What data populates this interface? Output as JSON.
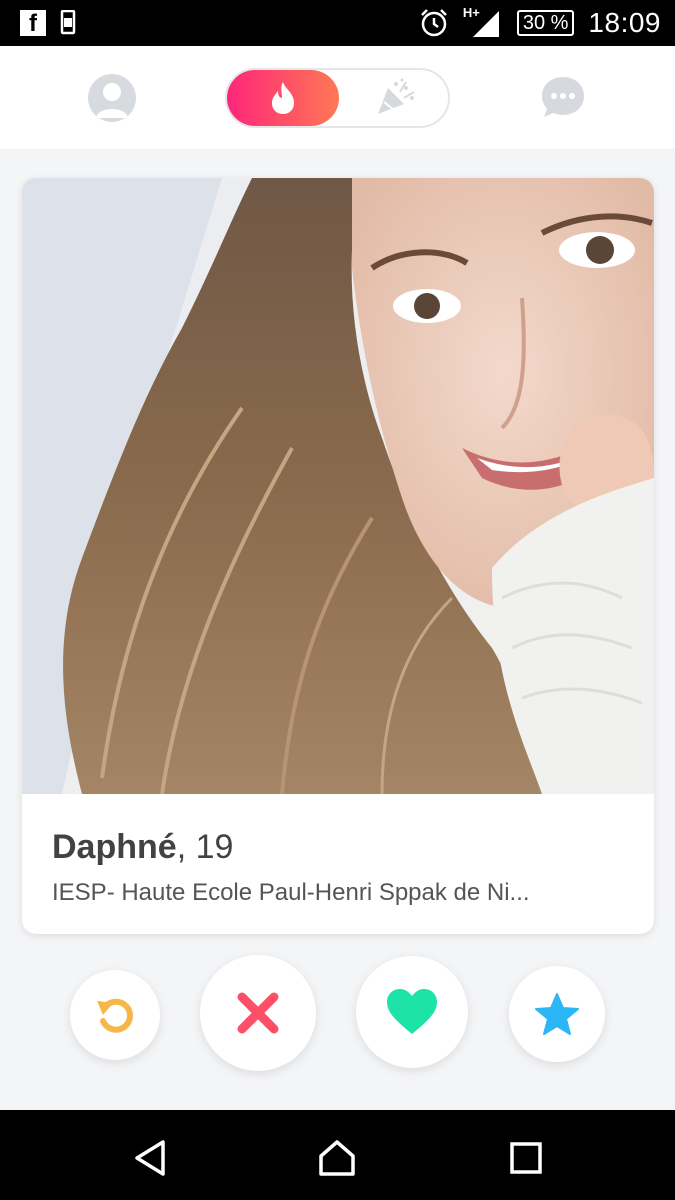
{
  "status_bar": {
    "network_type": "H+",
    "battery": "30 %",
    "time": "18:09"
  },
  "top_nav": {
    "profile_icon": "profile-icon",
    "active_tab_icon": "flame-icon",
    "inactive_tab_icon": "party-popper-icon",
    "messages_icon": "chat-bubble-icon",
    "accent_gradient": [
      "#fd267a",
      "#ff7854"
    ]
  },
  "card": {
    "name": "Daphné",
    "age_suffix": ", 19",
    "school": "IESP- Haute Ecole Paul-Henri Sppak de Ni..."
  },
  "actions": [
    {
      "icon": "rewind-icon",
      "color": "#f5b748"
    },
    {
      "icon": "nope-icon",
      "color": "#fd5068"
    },
    {
      "icon": "like-icon",
      "color": "#1ee3a8"
    },
    {
      "icon": "super-like-icon",
      "color": "#2db6f5"
    }
  ],
  "system_nav": {
    "icons": [
      "back-icon",
      "home-icon",
      "recents-icon"
    ]
  }
}
